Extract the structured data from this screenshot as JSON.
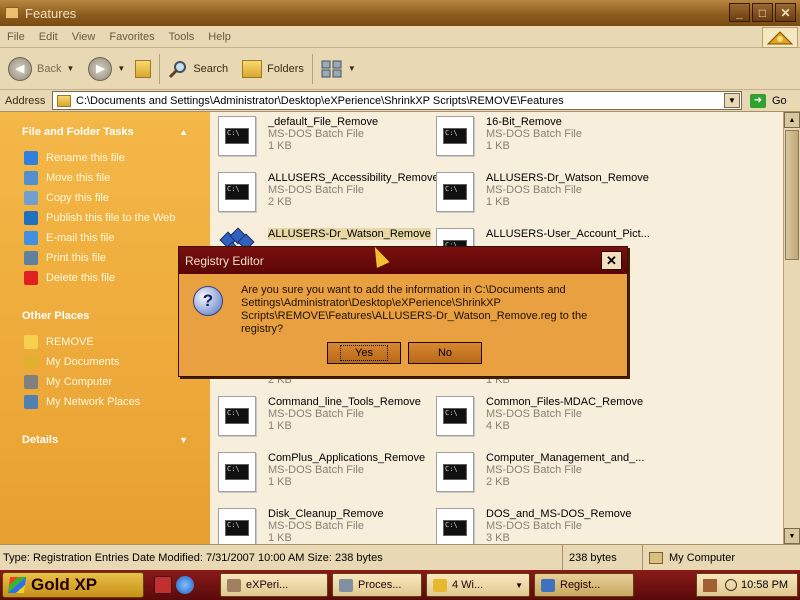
{
  "window": {
    "title": "Features",
    "min": "_",
    "max": "□",
    "close": "✕"
  },
  "menu": [
    "File",
    "Edit",
    "View",
    "Favorites",
    "Tools",
    "Help"
  ],
  "toolbar": {
    "back_label": "Back",
    "search_label": "Search",
    "folders_label": "Folders"
  },
  "address": {
    "label": "Address",
    "path": "C:\\Documents and Settings\\Administrator\\Desktop\\eXPerience\\ShrinkXP Scripts\\REMOVE\\Features",
    "go_label": "Go"
  },
  "tasks": {
    "title": "File and Folder Tasks",
    "items": [
      {
        "label": "Rename this file",
        "color": "#3080e0"
      },
      {
        "label": "Move this file",
        "color": "#5090d0"
      },
      {
        "label": "Copy this file",
        "color": "#70a0d0"
      },
      {
        "label": "Publish this file to the Web",
        "color": "#2070c0"
      },
      {
        "label": "E-mail this file",
        "color": "#4090e0"
      },
      {
        "label": "Print this file",
        "color": "#6080a0"
      },
      {
        "label": "Delete this file",
        "color": "#e02020"
      }
    ]
  },
  "places": {
    "title": "Other Places",
    "items": [
      {
        "label": "REMOVE",
        "color": "#f8d050"
      },
      {
        "label": "My Documents",
        "color": "#e0b030"
      },
      {
        "label": "My Computer",
        "color": "#808080"
      },
      {
        "label": "My Network Places",
        "color": "#5080b0"
      }
    ]
  },
  "details": {
    "title": "Details"
  },
  "files": [
    {
      "name": "_default_File_Remove",
      "type": "MS-DOS Batch File",
      "size": "1 KB"
    },
    {
      "name": "16-Bit_Remove",
      "type": "MS-DOS Batch File",
      "size": "1 KB"
    },
    {
      "name": "ALLUSERS_Accessibility_Remove",
      "type": "MS-DOS Batch File",
      "size": "2 KB"
    },
    {
      "name": "ALLUSERS-Dr_Watson_Remove",
      "type": "MS-DOS Batch File",
      "size": "1 KB"
    },
    {
      "name": "ALLUSERS-Dr_Watson_Remove",
      "type": "",
      "size": ""
    },
    {
      "name": "ALLUSERS-User_Account_Pict...",
      "type": "",
      "size": ""
    },
    {
      "name": "",
      "type": "",
      "size": "2 KB"
    },
    {
      "name": "",
      "type": "",
      "size": "1 KB"
    },
    {
      "name": "Command_line_Tools_Remove",
      "type": "MS-DOS Batch File",
      "size": "1 KB"
    },
    {
      "name": "Common_Files-MDAC_Remove",
      "type": "MS-DOS Batch File",
      "size": "4 KB"
    },
    {
      "name": "ComPlus_Applications_Remove",
      "type": "MS-DOS Batch File",
      "size": "1 KB"
    },
    {
      "name": "Computer_Management_and_...",
      "type": "MS-DOS Batch File",
      "size": "2 KB"
    },
    {
      "name": "Disk_Cleanup_Remove",
      "type": "MS-DOS Batch File",
      "size": "1 KB"
    },
    {
      "name": "DOS_and_MS-DOS_Remove",
      "type": "MS-DOS Batch File",
      "size": "3 KB"
    }
  ],
  "status": {
    "info": "Type: Registration Entries Date Modified: 7/31/2007 10:00 AM Size: 238 bytes",
    "size": "238 bytes",
    "zone": "My Computer"
  },
  "dialog": {
    "title": "Registry Editor",
    "close": "✕",
    "message": "Are you sure you want to add the information in C:\\Documents and Settings\\Administrator\\Desktop\\eXPerience\\ShrinkXP Scripts\\REMOVE\\Features\\ALLUSERS-Dr_Watson_Remove.reg to the registry?",
    "yes": "Yes",
    "no": "No"
  },
  "taskbar": {
    "start": "Gold XP",
    "tasks": [
      "eXPeri...",
      "Proces...",
      "4 Wi...",
      "Regist..."
    ],
    "time": "10:58 PM"
  }
}
